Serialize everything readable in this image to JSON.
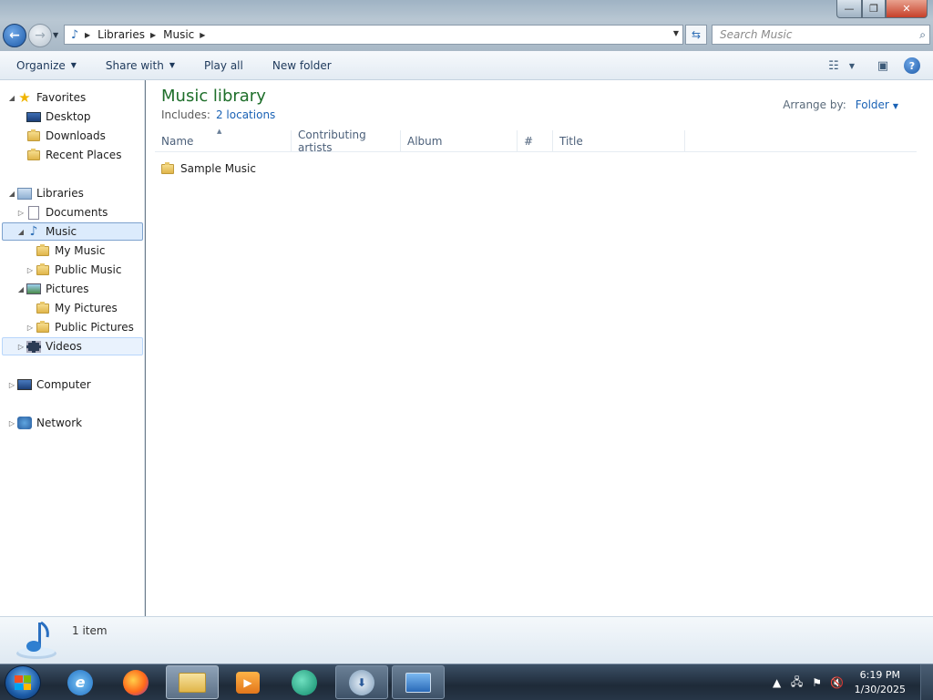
{
  "window": {
    "controls": {
      "minimize": "—",
      "maximize": "❐",
      "close": "✕"
    }
  },
  "address": {
    "crumbs": [
      "Libraries",
      "Music"
    ],
    "search_placeholder": "Search Music"
  },
  "toolbar": {
    "organize": "Organize",
    "share_with": "Share with",
    "play_all": "Play all",
    "new_folder": "New folder"
  },
  "nav": {
    "favorites": "Favorites",
    "desktop": "Desktop",
    "downloads": "Downloads",
    "recent_places": "Recent Places",
    "libraries": "Libraries",
    "documents": "Documents",
    "music": "Music",
    "my_music": "My Music",
    "public_music": "Public Music",
    "pictures": "Pictures",
    "my_pictures": "My Pictures",
    "public_pictures": "Public Pictures",
    "videos": "Videos",
    "computer": "Computer",
    "network": "Network"
  },
  "content": {
    "title": "Music library",
    "includes_label": "Includes:",
    "includes_link": "2 locations",
    "arrange_label": "Arrange by:",
    "arrange_value": "Folder",
    "columns": [
      "Name",
      "Contributing artists",
      "Album",
      "#",
      "Title"
    ],
    "rows": [
      {
        "name": "Sample Music"
      }
    ]
  },
  "details": {
    "count": "1 item"
  },
  "taskbar": {
    "time": "6:19 PM",
    "date": "1/30/2025"
  }
}
